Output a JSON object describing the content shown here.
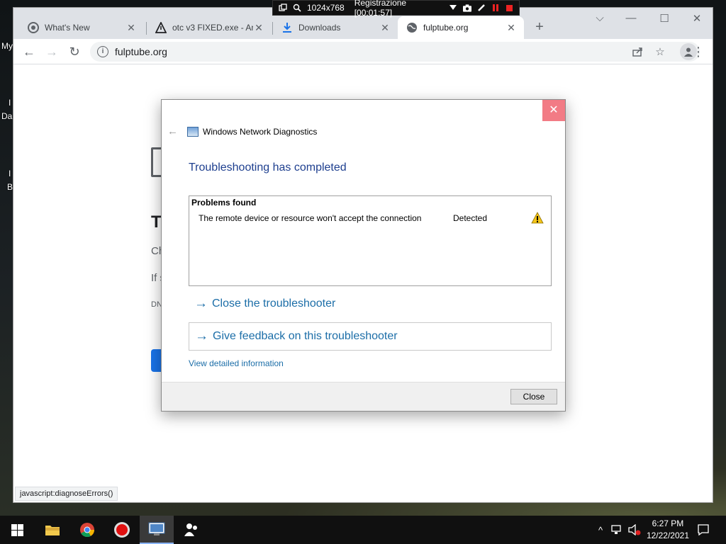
{
  "desktop": {
    "labels": [
      "My",
      "I",
      "Da",
      "I",
      "B"
    ]
  },
  "recorder": {
    "resolution": "1024x768",
    "status": "Registrazione [00:01:57]"
  },
  "browser": {
    "tabs": [
      {
        "title": "What's New",
        "icon": "chrome-icon"
      },
      {
        "title": "otc v3 FIXED.exe - An",
        "icon": "warning-icon"
      },
      {
        "title": "Downloads",
        "icon": "download-icon"
      },
      {
        "title": "fulptube.org",
        "icon": "globe-icon"
      }
    ],
    "url": "fulptube.org",
    "status_url": "javascript:diagnoseErrors()"
  },
  "page": {
    "heading_fragment": "T",
    "line1_fragment": "Ch",
    "line2_fragment": "If s",
    "code_fragment": "DN"
  },
  "dialog": {
    "app_title": "Windows Network Diagnostics",
    "heading": "Troubleshooting has completed",
    "problems_header": "Problems found",
    "problem": {
      "description": "The remote device or resource won't accept the connection",
      "status": "Detected"
    },
    "close_troubleshooter": "Close the troubleshooter",
    "give_feedback": "Give feedback on this troubleshooter",
    "view_details": "View detailed information",
    "close_button": "Close"
  },
  "taskbar": {
    "time": "6:27 PM",
    "date": "12/22/2021"
  },
  "colors": {
    "link_blue": "#1c6ea8",
    "heading_blue": "#1e3f8f",
    "chrome_blue": "#1a73e8",
    "close_red": "#e81123"
  }
}
